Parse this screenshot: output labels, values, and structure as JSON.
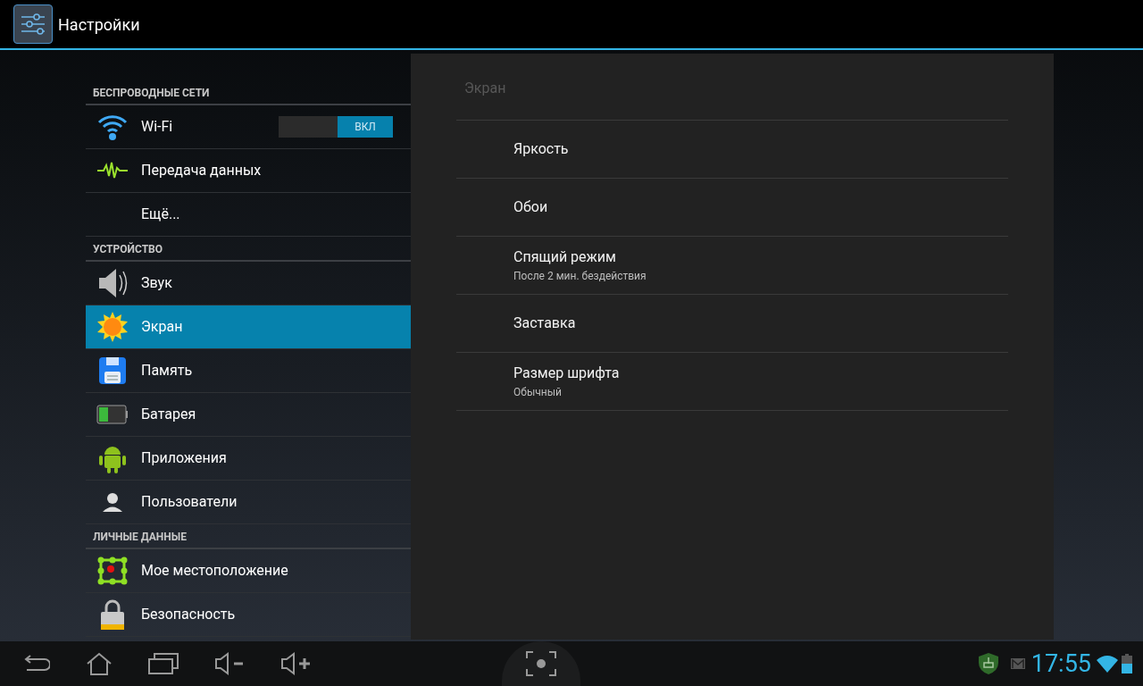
{
  "action_bar": {
    "title": "Настройки"
  },
  "sidebar": {
    "sections": [
      {
        "header": "БЕСПРОВОДНЫЕ СЕТИ",
        "items": [
          {
            "label": "Wi-Fi",
            "selected": false,
            "toggle": {
              "label": "ВКЛ",
              "on": true
            }
          },
          {
            "label": "Передача данных",
            "selected": false
          },
          {
            "label": "Ещё...",
            "selected": false
          }
        ]
      },
      {
        "header": "УСТРОЙСТВО",
        "items": [
          {
            "label": "Звук",
            "selected": false
          },
          {
            "label": "Экран",
            "selected": true
          },
          {
            "label": "Память",
            "selected": false
          },
          {
            "label": "Батарея",
            "selected": false
          },
          {
            "label": "Приложения",
            "selected": false
          },
          {
            "label": "Пользователи",
            "selected": false
          }
        ]
      },
      {
        "header": "ЛИЧНЫЕ ДАННЫЕ",
        "items": [
          {
            "label": "Мое местоположение",
            "selected": false
          },
          {
            "label": "Безопасность",
            "selected": false
          }
        ]
      }
    ]
  },
  "detail": {
    "title": "Экран",
    "items": [
      {
        "title": "Яркость"
      },
      {
        "title": "Обои"
      },
      {
        "title": "Спящий режим",
        "summary": "После 2 мин. бездействия"
      },
      {
        "title": "Заставка"
      },
      {
        "title": "Размер шрифта",
        "summary": "Обычный"
      }
    ]
  },
  "status_bar": {
    "time": "17:55"
  }
}
